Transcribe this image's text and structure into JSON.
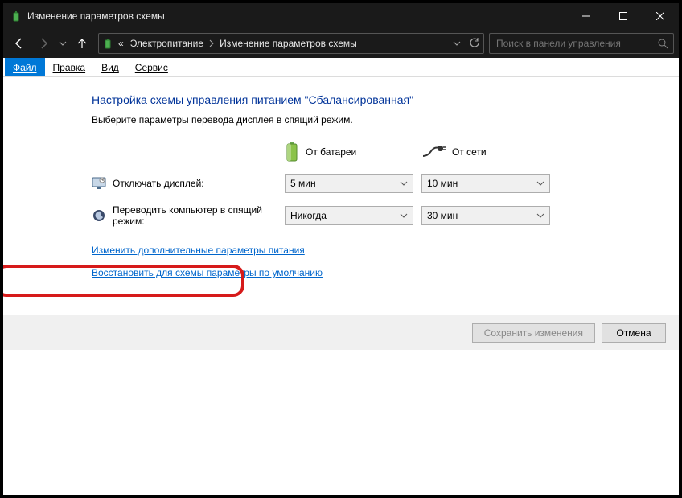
{
  "window": {
    "title": "Изменение параметров схемы"
  },
  "nav": {
    "crumb_prefix": "«",
    "crumb1": "Электропитание",
    "crumb2": "Изменение параметров схемы",
    "search_placeholder": "Поиск в панели управления"
  },
  "menu": {
    "file": "Файл",
    "edit": "Правка",
    "view": "Вид",
    "service": "Сервис"
  },
  "page": {
    "title": "Настройка схемы управления питанием \"Сбалансированная\"",
    "subtitle": "Выберите параметры перевода дисплея в спящий режим."
  },
  "columns": {
    "battery": "От батареи",
    "ac": "От сети"
  },
  "rows": {
    "display_off": "Отключать дисплей:",
    "sleep": "Переводить компьютер в спящий режим:"
  },
  "values": {
    "display_battery": "5 мин",
    "display_ac": "10 мин",
    "sleep_battery": "Никогда",
    "sleep_ac": "30 мин"
  },
  "links": {
    "advanced": "Изменить дополнительные параметры питания",
    "restore": "Восстановить для схемы параметры по умолчанию"
  },
  "buttons": {
    "save": "Сохранить изменения",
    "cancel": "Отмена"
  }
}
